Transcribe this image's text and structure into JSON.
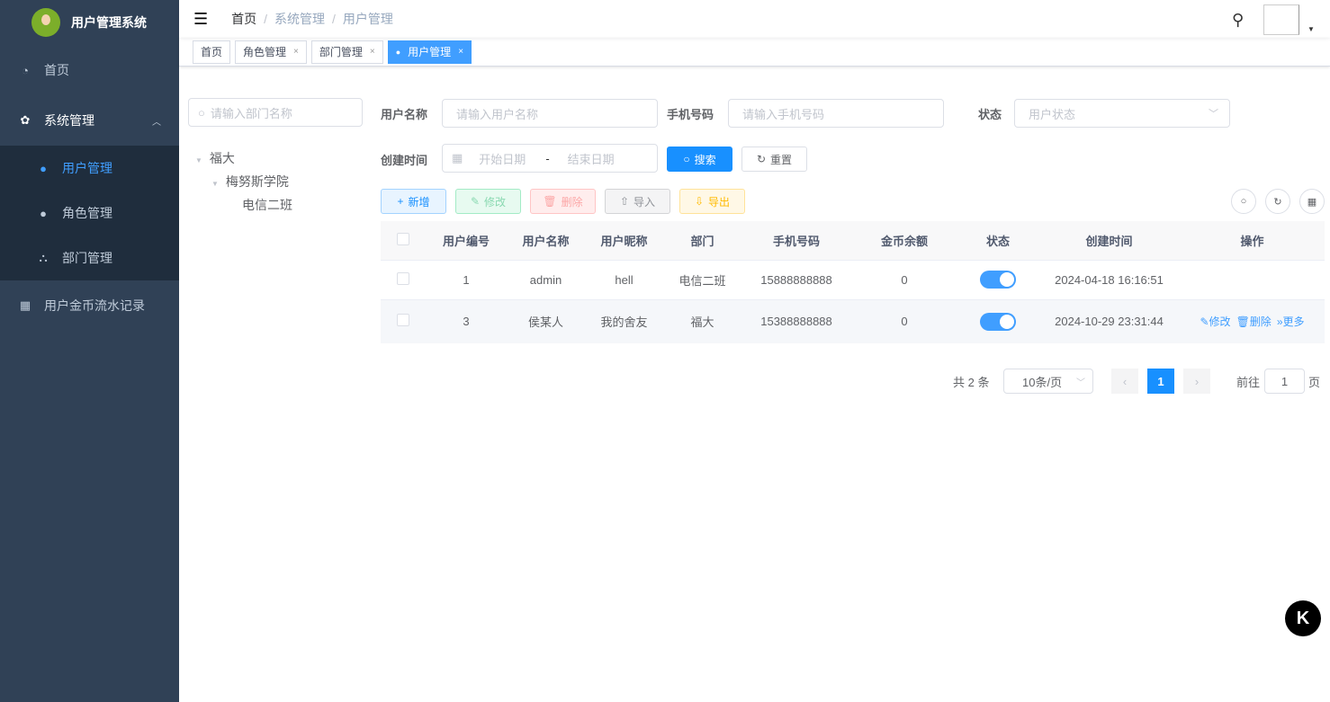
{
  "app": {
    "title": "用户管理系统"
  },
  "sidebar": {
    "items": [
      {
        "label": "首页"
      },
      {
        "label": "系统管理"
      },
      {
        "label": "用户管理"
      },
      {
        "label": "角色管理"
      },
      {
        "label": "部门管理"
      },
      {
        "label": "用户金币流水记录"
      }
    ]
  },
  "breadcrumb": [
    "首页",
    "系统管理",
    "用户管理"
  ],
  "tabs": [
    {
      "label": "首页"
    },
    {
      "label": "角色管理"
    },
    {
      "label": "部门管理"
    },
    {
      "label": "用户管理"
    }
  ],
  "tree": {
    "search_placeholder": "请输入部门名称",
    "nodes": [
      "福大",
      "梅努斯学院",
      "电信二班"
    ]
  },
  "filters": {
    "username_label": "用户名称",
    "username_placeholder": "请输入用户名称",
    "phone_label": "手机号码",
    "phone_placeholder": "请输入手机号码",
    "status_label": "状态",
    "status_placeholder": "用户状态",
    "time_label": "创建时间",
    "start_placeholder": "开始日期",
    "sep": "-",
    "end_placeholder": "结束日期",
    "search": "搜索",
    "reset": "重置"
  },
  "toolbar": {
    "add": "新增",
    "edit": "修改",
    "delete": "删除",
    "import": "导入",
    "export": "导出"
  },
  "table": {
    "headers": [
      "用户编号",
      "用户名称",
      "用户昵称",
      "部门",
      "手机号码",
      "金币余额",
      "状态",
      "创建时间",
      "操作"
    ],
    "rows": [
      [
        "1",
        "admin",
        "hell",
        "电信二班",
        "15888888888",
        "0",
        "2024-04-18 16:16:51"
      ],
      [
        "3",
        "侯某人",
        "我的舍友",
        "福大",
        "15388888888",
        "0",
        "2024-10-29 23:31:44"
      ]
    ],
    "actions": {
      "edit": "修改",
      "delete": "删除",
      "more": "更多"
    }
  },
  "pagination": {
    "total": "共 2 条",
    "size": "10条/页",
    "page": "1",
    "goto": "前往",
    "goto_value": "1",
    "unit": "页"
  }
}
